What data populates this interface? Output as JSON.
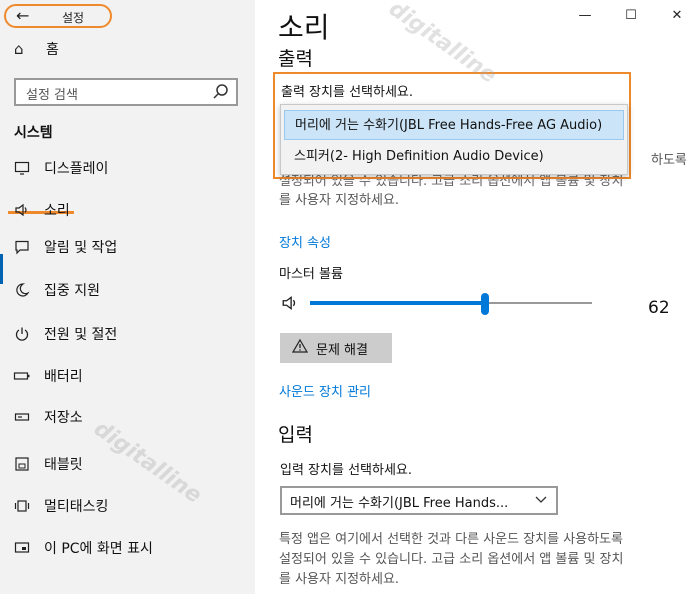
{
  "titlebar": {
    "back_icon": "←",
    "title": "설정"
  },
  "sidebar": {
    "home_icon": "⌂",
    "home_label": "홈",
    "search_placeholder": "설정 검색",
    "section_title": "시스템",
    "items": [
      {
        "icon": "monitor-icon",
        "glyph": "▭",
        "label": "디스플레이"
      },
      {
        "icon": "speaker-icon",
        "glyph": "🔈",
        "label": "소리"
      },
      {
        "icon": "notification-icon",
        "glyph": "▢",
        "label": "알림 및 작업"
      },
      {
        "icon": "moon-icon",
        "glyph": "☾",
        "label": "집중 지원"
      },
      {
        "icon": "power-icon",
        "glyph": "⏻",
        "label": "전원 및 절전"
      },
      {
        "icon": "battery-icon",
        "glyph": "▭",
        "label": "배터리"
      },
      {
        "icon": "storage-icon",
        "glyph": "▬",
        "label": "저장소"
      },
      {
        "icon": "tablet-icon",
        "glyph": "▣",
        "label": "태블릿"
      },
      {
        "icon": "multitask-icon",
        "glyph": "▦",
        "label": "멀티태스킹"
      },
      {
        "icon": "project-icon",
        "glyph": "▭",
        "label": "이 PC에 화면 표시"
      }
    ]
  },
  "window": {
    "minimize": "—",
    "maximize": "☐",
    "close": "✕"
  },
  "main": {
    "title": "소리",
    "output": {
      "heading": "출력",
      "select_label": "출력 장치를 선택하세요.",
      "options": [
        "머리에 거는 수화기(JBL Free Hands-Free AG Audio)",
        "스피커(2- High Definition Audio Device)"
      ],
      "selected_index": 0,
      "para_fragment_1": "하도록",
      "para_line2": "설정되어 있을 수 있습니다. 고급 소리 옵션에서 앱 볼륨 및 장치",
      "para_line3": "를 사용자 지정하세요.",
      "device_properties": "장치 속성",
      "master_volume_label": "마스터 볼륨",
      "volume": 62,
      "troubleshoot": "문제 해결",
      "manage_devices": "사운드 장치 관리"
    },
    "input": {
      "heading": "입력",
      "select_label": "입력 장치를 선택하세요.",
      "selected": "머리에 거는 수화기(JBL Free Hands...",
      "para_line1": "특정 앱은 여기에서 선택한 것과 다른 사운드 장치를 사용하도록",
      "para_line2": "설정되어 있을 수 있습니다. 고급 소리 옵션에서 앱 볼륨 및 장치",
      "para_line3": "를 사용자 지정하세요."
    }
  },
  "watermarks": [
    "digitalline",
    "digitalline"
  ],
  "colors": {
    "highlight": "#ef8a2c",
    "accent": "#0078d7",
    "selected_bg": "#cce4f7"
  }
}
